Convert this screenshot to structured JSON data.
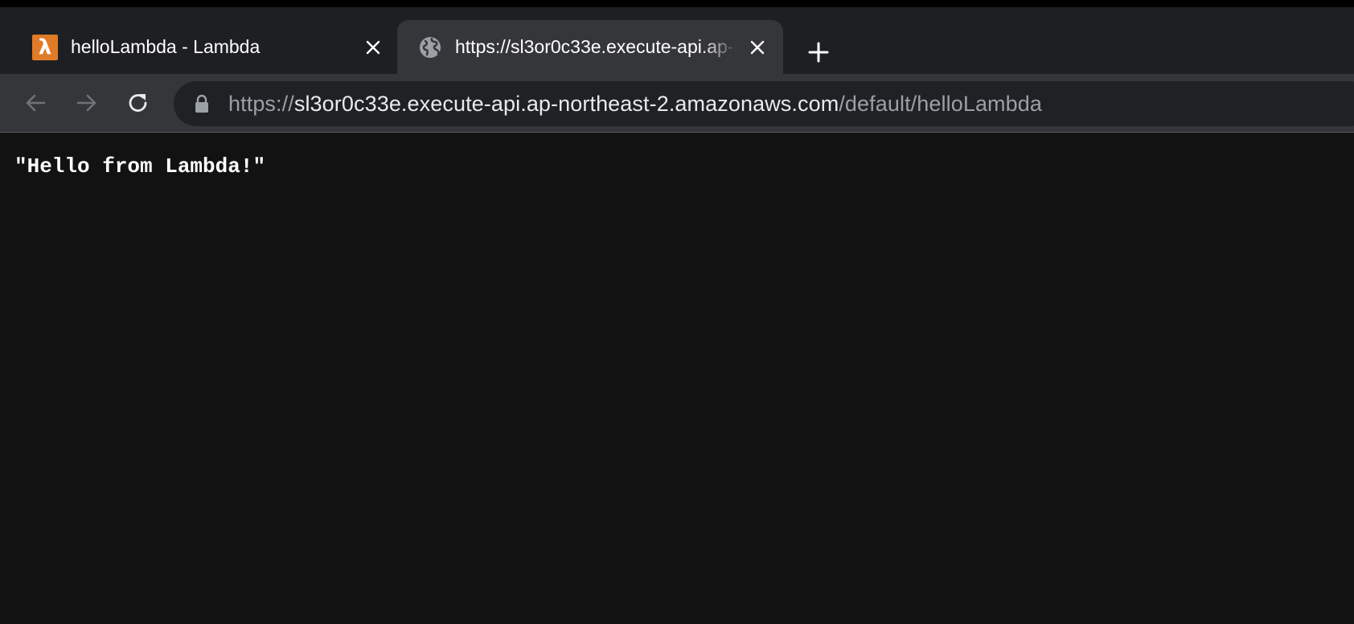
{
  "tabs": [
    {
      "title": "helloLambda - Lambda",
      "icon": "aws-lambda-icon",
      "icon_glyph": "λ",
      "active": false
    },
    {
      "title": "https://sl3or0c33e.execute-api.ap-northeast-2.amazonaws.com/default/helloLambda",
      "icon": "globe-icon",
      "active": true
    }
  ],
  "address_bar": {
    "scheme": "https://",
    "host": "sl3or0c33e.execute-api.ap-northeast-2.amazonaws.com",
    "path": "/default/helloLambda"
  },
  "page": {
    "body_text": "\"Hello from Lambda!\""
  },
  "colors": {
    "lambda_orange": "#e07b27",
    "page_background": "#121212",
    "toolbar": "#35363a",
    "omnibox": "#202124"
  }
}
